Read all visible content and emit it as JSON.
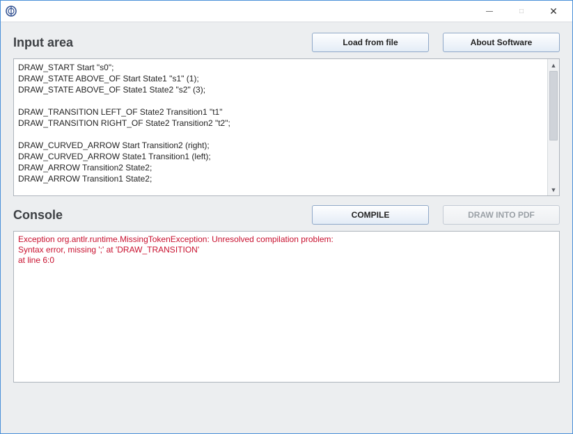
{
  "titlebar": {
    "minimize": "—",
    "maximize": "□",
    "close": "✕"
  },
  "input": {
    "heading": "Input area",
    "load_button": "Load from file",
    "about_button": "About Software",
    "code": "DRAW_START Start \"s0\";\nDRAW_STATE ABOVE_OF Start State1 \"s1\" (1);\nDRAW_STATE ABOVE_OF State1 State2 \"s2\" (3);\n\nDRAW_TRANSITION LEFT_OF State2 Transition1 \"t1\"\nDRAW_TRANSITION RIGHT_OF State2 Transition2 \"t2\";\n\nDRAW_CURVED_ARROW Start Transition2 (right);\nDRAW_CURVED_ARROW State1 Transition1 (left);\nDRAW_ARROW Transition2 State2;\nDRAW_ARROW Transition1 State2;"
  },
  "console": {
    "heading": "Console",
    "compile_button": "COMPILE",
    "draw_button": "DRAW INTO PDF",
    "output": "Exception org.antlr.runtime.MissingTokenException: Unresolved compilation problem:\nSyntax error, missing ';' at 'DRAW_TRANSITION'\nat line 6:0"
  }
}
